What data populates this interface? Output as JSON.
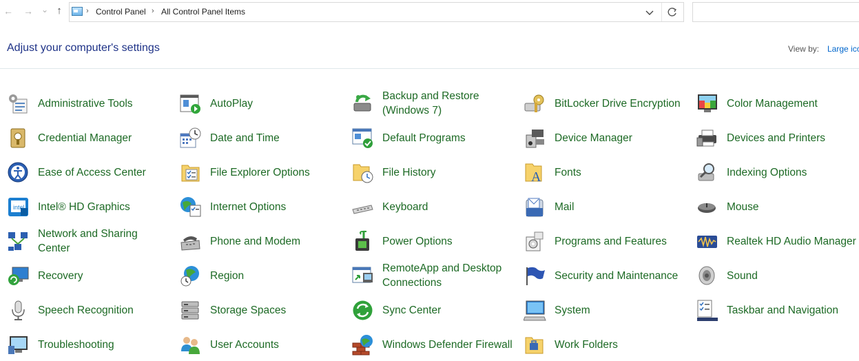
{
  "nav": {
    "back": "←",
    "forward": "→",
    "recent": "⌄",
    "up": "↑"
  },
  "address": {
    "crumbs": [
      "Control Panel",
      "All Control Panel Items"
    ],
    "separator": "›"
  },
  "header": {
    "title": "Adjust your computer's settings",
    "view_by_label": "View by:",
    "view_by_value": "Large icons"
  },
  "items": [
    {
      "label": "Administrative Tools",
      "icon": "administrative-tools-icon"
    },
    {
      "label": "AutoPlay",
      "icon": "autoplay-icon"
    },
    {
      "label": "Backup and Restore (Windows 7)",
      "icon": "backup-restore-icon"
    },
    {
      "label": "BitLocker Drive Encryption",
      "icon": "bitlocker-icon"
    },
    {
      "label": "Color Management",
      "icon": "color-management-icon"
    },
    {
      "label": "Credential Manager",
      "icon": "credential-manager-icon"
    },
    {
      "label": "Date and Time",
      "icon": "date-time-icon"
    },
    {
      "label": "Default Programs",
      "icon": "default-programs-icon"
    },
    {
      "label": "Device Manager",
      "icon": "device-manager-icon"
    },
    {
      "label": "Devices and Printers",
      "icon": "devices-printers-icon"
    },
    {
      "label": "Ease of Access Center",
      "icon": "ease-of-access-icon"
    },
    {
      "label": "File Explorer Options",
      "icon": "file-explorer-options-icon"
    },
    {
      "label": "File History",
      "icon": "file-history-icon"
    },
    {
      "label": "Fonts",
      "icon": "fonts-icon"
    },
    {
      "label": "Indexing Options",
      "icon": "indexing-options-icon"
    },
    {
      "label": "Intel® HD Graphics",
      "icon": "intel-graphics-icon"
    },
    {
      "label": "Internet Options",
      "icon": "internet-options-icon"
    },
    {
      "label": "Keyboard",
      "icon": "keyboard-icon"
    },
    {
      "label": "Mail",
      "icon": "mail-icon"
    },
    {
      "label": "Mouse",
      "icon": "mouse-icon"
    },
    {
      "label": "Network and Sharing Center",
      "icon": "network-sharing-icon"
    },
    {
      "label": "Phone and Modem",
      "icon": "phone-modem-icon"
    },
    {
      "label": "Power Options",
      "icon": "power-options-icon"
    },
    {
      "label": "Programs and Features",
      "icon": "programs-features-icon"
    },
    {
      "label": "Realtek HD Audio Manager",
      "icon": "realtek-audio-icon"
    },
    {
      "label": "Recovery",
      "icon": "recovery-icon"
    },
    {
      "label": "Region",
      "icon": "region-icon"
    },
    {
      "label": "RemoteApp and Desktop Connections",
      "icon": "remoteapp-icon"
    },
    {
      "label": "Security and Maintenance",
      "icon": "security-maintenance-icon"
    },
    {
      "label": "Sound",
      "icon": "sound-icon"
    },
    {
      "label": "Speech Recognition",
      "icon": "speech-recognition-icon"
    },
    {
      "label": "Storage Spaces",
      "icon": "storage-spaces-icon"
    },
    {
      "label": "Sync Center",
      "icon": "sync-center-icon"
    },
    {
      "label": "System",
      "icon": "system-icon"
    },
    {
      "label": "Taskbar and Navigation",
      "icon": "taskbar-navigation-icon"
    },
    {
      "label": "Troubleshooting",
      "icon": "troubleshooting-icon"
    },
    {
      "label": "User Accounts",
      "icon": "user-accounts-icon"
    },
    {
      "label": "Windows Defender Firewall",
      "icon": "firewall-icon"
    },
    {
      "label": "Work Folders",
      "icon": "work-folders-icon"
    }
  ],
  "colors": {
    "link": "#1d6a25",
    "heading": "#1e3287",
    "view_value": "#0066cc",
    "divider": "#dfe8ea"
  }
}
